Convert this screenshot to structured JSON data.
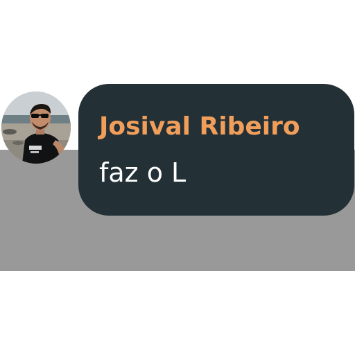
{
  "message": {
    "sender_name": "Josival Ribeiro",
    "text": "faz o L",
    "name_color": "#f19e5b",
    "text_color": "#ffffff",
    "bubble_color": "#233036"
  },
  "avatar": {
    "icon": "profile-photo-avatar"
  }
}
